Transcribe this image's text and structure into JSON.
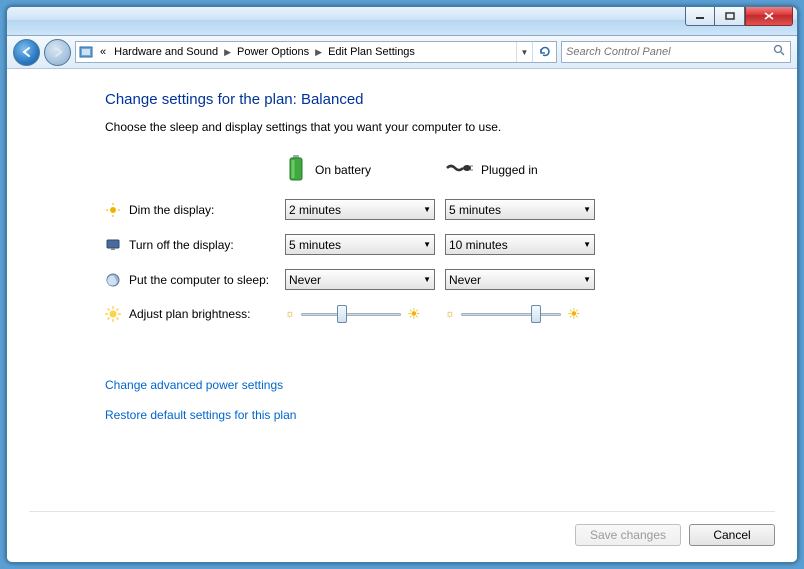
{
  "breadcrumbs": {
    "prefix": "«",
    "items": [
      "Hardware and Sound",
      "Power Options",
      "Edit Plan Settings"
    ]
  },
  "search": {
    "placeholder": "Search Control Panel"
  },
  "heading": "Change settings for the plan: Balanced",
  "subheading": "Choose the sleep and display settings that you want your computer to use.",
  "columns": {
    "battery": "On battery",
    "plugged": "Plugged in"
  },
  "rows": {
    "dim": {
      "label": "Dim the display:",
      "battery": "2 minutes",
      "plugged": "5 minutes"
    },
    "off": {
      "label": "Turn off the display:",
      "battery": "5 minutes",
      "plugged": "10 minutes"
    },
    "sleep": {
      "label": "Put the computer to sleep:",
      "battery": "Never",
      "plugged": "Never"
    },
    "brightness": {
      "label": "Adjust plan brightness:",
      "battery_pct": 40,
      "plugged_pct": 78
    }
  },
  "links": {
    "advanced": "Change advanced power settings",
    "restore": "Restore default settings for this plan"
  },
  "buttons": {
    "save": "Save changes",
    "cancel": "Cancel"
  }
}
